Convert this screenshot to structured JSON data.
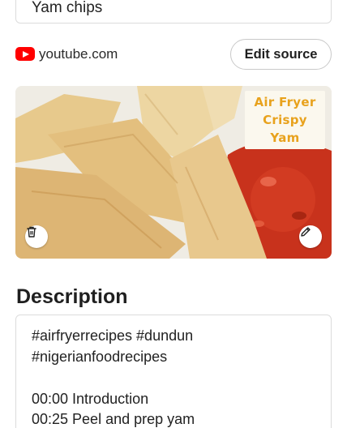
{
  "title_field": {
    "value": "Yam chips"
  },
  "source": {
    "icon": "youtube-icon",
    "domain": "youtube.com",
    "edit_label": "Edit source"
  },
  "image": {
    "overlay_lines": [
      "Air Fryer",
      "Crispy",
      "Yam"
    ]
  },
  "description": {
    "heading": "Description",
    "lines": [
      "#airfryerrecipes  #dundun",
      "#nigerianfoodrecipes",
      "",
      "00:00 Introduction",
      "00:25 Peel and prep yam"
    ]
  }
}
